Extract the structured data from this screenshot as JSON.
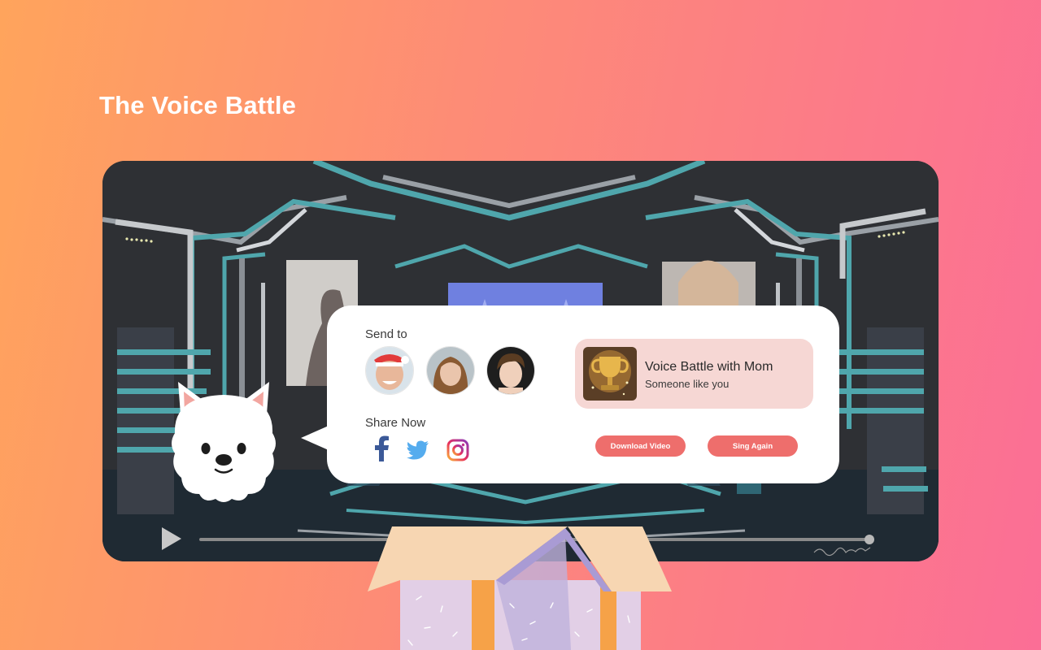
{
  "page": {
    "title": "The Voice Battle"
  },
  "share": {
    "send_to_label": "Send to",
    "share_now_label": "Share Now",
    "contacts": [
      "contact-1",
      "contact-2",
      "contact-3"
    ],
    "social": [
      "facebook",
      "twitter",
      "instagram"
    ]
  },
  "song": {
    "title": "Voice Battle with Mom",
    "subtitle": "Someone like you"
  },
  "actions": {
    "download_label": "Download Video",
    "sing_again_label": "Sing Again"
  },
  "colors": {
    "accent": "#EE6E6C",
    "song_card_bg": "#F6D7D4",
    "stage_cyan": "#4FA6AC",
    "facebook": "#3B5998",
    "twitter": "#55ACEE"
  },
  "icons": {
    "play": "play-icon",
    "facebook": "facebook-icon",
    "twitter": "twitter-icon",
    "instagram": "instagram-icon"
  }
}
